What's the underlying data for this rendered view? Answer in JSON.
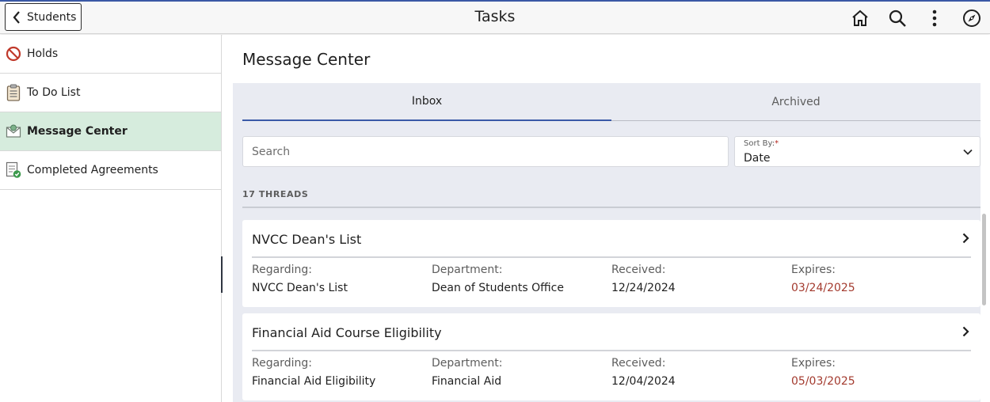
{
  "header": {
    "back_label": "Students",
    "title": "Tasks",
    "icons": [
      "home-icon",
      "search-icon",
      "more-vertical-icon",
      "compass-icon"
    ]
  },
  "sidebar": {
    "items": [
      {
        "label": "Holds",
        "icon": "no-entry-icon"
      },
      {
        "label": "To Do List",
        "icon": "clipboard-icon"
      },
      {
        "label": "Message Center",
        "icon": "message-envelope-icon",
        "active": true
      },
      {
        "label": "Completed Agreements",
        "icon": "document-check-icon"
      }
    ]
  },
  "main": {
    "page_title": "Message Center",
    "tabs": [
      {
        "label": "Inbox",
        "active": true
      },
      {
        "label": "Archived",
        "active": false
      }
    ],
    "search": {
      "placeholder": "Search",
      "value": ""
    },
    "sort": {
      "label": "Sort By:",
      "required_mark": "*",
      "value": "Date"
    },
    "thread_count": "17 THREADS",
    "labels": {
      "regarding": "Regarding:",
      "department": "Department:",
      "received": "Received:",
      "expires": "Expires:"
    },
    "threads": [
      {
        "title": "NVCC Dean's List",
        "regarding": "NVCC Dean's List",
        "department": "Dean of Students Office",
        "received": "12/24/2024",
        "expires": "03/24/2025"
      },
      {
        "title": "Financial Aid Course Eligibility",
        "regarding": "Financial Aid Eligibility",
        "department": "Financial Aid",
        "received": "12/04/2024",
        "expires": "05/03/2025"
      }
    ]
  },
  "colors": {
    "accent": "#3b5aa8",
    "active_sidebar": "#d6ecdd",
    "expires_text": "#a33a2e",
    "panel_bg": "#e9ebf2"
  }
}
